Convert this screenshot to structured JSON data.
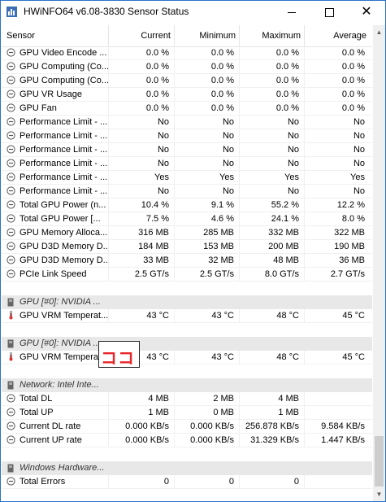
{
  "window": {
    "title": "HWiNFO64 v6.08-3830 Sensor Status"
  },
  "columns": [
    "Sensor",
    "Current",
    "Minimum",
    "Maximum",
    "Average"
  ],
  "rows": [
    {
      "kind": "sensor",
      "icon": "gauge-icon",
      "name": "GPU Video Encode ...",
      "cur": "0.0 %",
      "min": "0.0 %",
      "max": "0.0 %",
      "avg": "0.0 %"
    },
    {
      "kind": "sensor",
      "icon": "gauge-icon",
      "name": "GPU Computing (Co...",
      "cur": "0.0 %",
      "min": "0.0 %",
      "max": "0.0 %",
      "avg": "0.0 %"
    },
    {
      "kind": "sensor",
      "icon": "gauge-icon",
      "name": "GPU Computing (Co...",
      "cur": "0.0 %",
      "min": "0.0 %",
      "max": "0.0 %",
      "avg": "0.0 %"
    },
    {
      "kind": "sensor",
      "icon": "gauge-icon",
      "name": "GPU VR Usage",
      "cur": "0.0 %",
      "min": "0.0 %",
      "max": "0.0 %",
      "avg": "0.0 %"
    },
    {
      "kind": "sensor",
      "icon": "gauge-icon",
      "name": "GPU Fan",
      "cur": "0.0 %",
      "min": "0.0 %",
      "max": "0.0 %",
      "avg": "0.0 %"
    },
    {
      "kind": "sensor",
      "icon": "gauge-icon",
      "name": "Performance Limit - ...",
      "cur": "No",
      "min": "No",
      "max": "No",
      "avg": "No"
    },
    {
      "kind": "sensor",
      "icon": "gauge-icon",
      "name": "Performance Limit - ...",
      "cur": "No",
      "min": "No",
      "max": "No",
      "avg": "No"
    },
    {
      "kind": "sensor",
      "icon": "gauge-icon",
      "name": "Performance Limit - ...",
      "cur": "No",
      "min": "No",
      "max": "No",
      "avg": "No"
    },
    {
      "kind": "sensor",
      "icon": "gauge-icon",
      "name": "Performance Limit - ...",
      "cur": "No",
      "min": "No",
      "max": "No",
      "avg": "No"
    },
    {
      "kind": "sensor",
      "icon": "gauge-icon",
      "name": "Performance Limit - ...",
      "cur": "Yes",
      "min": "Yes",
      "max": "Yes",
      "avg": "Yes"
    },
    {
      "kind": "sensor",
      "icon": "gauge-icon",
      "name": "Performance Limit - ...",
      "cur": "No",
      "min": "No",
      "max": "No",
      "avg": "No"
    },
    {
      "kind": "sensor",
      "icon": "gauge-icon",
      "name": "Total GPU Power (n...",
      "cur": "10.4 %",
      "min": "9.1 %",
      "max": "55.2 %",
      "avg": "12.2 %"
    },
    {
      "kind": "sensor",
      "icon": "gauge-icon",
      "name": "Total GPU Power [...",
      "cur": "7.5 %",
      "min": "4.6 %",
      "max": "24.1 %",
      "avg": "8.0 %"
    },
    {
      "kind": "sensor",
      "icon": "gauge-icon",
      "name": "GPU Memory Alloca...",
      "cur": "316 MB",
      "min": "285 MB",
      "max": "332 MB",
      "avg": "322 MB"
    },
    {
      "kind": "sensor",
      "icon": "gauge-icon",
      "name": "GPU D3D Memory D...",
      "cur": "184 MB",
      "min": "153 MB",
      "max": "200 MB",
      "avg": "190 MB"
    },
    {
      "kind": "sensor",
      "icon": "gauge-icon",
      "name": "GPU D3D Memory D...",
      "cur": "33 MB",
      "min": "32 MB",
      "max": "48 MB",
      "avg": "36 MB"
    },
    {
      "kind": "sensor",
      "icon": "gauge-icon",
      "name": "PCIe Link Speed",
      "cur": "2.5 GT/s",
      "min": "2.5 GT/s",
      "max": "8.0 GT/s",
      "avg": "2.7 GT/s"
    },
    {
      "kind": "blank"
    },
    {
      "kind": "group",
      "icon": "sensor-chip-icon",
      "name": "GPU [#0]: NVIDIA ..."
    },
    {
      "kind": "sensor",
      "icon": "thermometer-icon",
      "name": "GPU VRM Temperat...",
      "cur": "43 °C",
      "min": "43 °C",
      "max": "48 °C",
      "avg": "45 °C"
    },
    {
      "kind": "blank"
    },
    {
      "kind": "group",
      "icon": "sensor-chip-icon",
      "name": "GPU [#0]: NVIDIA ..."
    },
    {
      "kind": "sensor",
      "icon": "thermometer-icon",
      "name": "GPU VRM Temperat...",
      "cur": "43 °C",
      "min": "43 °C",
      "max": "48 °C",
      "avg": "45 °C"
    },
    {
      "kind": "blank"
    },
    {
      "kind": "group",
      "icon": "sensor-chip-icon",
      "name": "Network: Intel Inte..."
    },
    {
      "kind": "sensor",
      "icon": "gauge-icon",
      "name": "Total DL",
      "cur": "4 MB",
      "min": "2 MB",
      "max": "4 MB",
      "avg": ""
    },
    {
      "kind": "sensor",
      "icon": "gauge-icon",
      "name": "Total UP",
      "cur": "1 MB",
      "min": "0 MB",
      "max": "1 MB",
      "avg": ""
    },
    {
      "kind": "sensor",
      "icon": "gauge-icon",
      "name": "Current DL rate",
      "cur": "0.000 KB/s",
      "min": "0.000 KB/s",
      "max": "256.878 KB/s",
      "avg": "9.584 KB/s"
    },
    {
      "kind": "sensor",
      "icon": "gauge-icon",
      "name": "Current UP rate",
      "cur": "0.000 KB/s",
      "min": "0.000 KB/s",
      "max": "31.329 KB/s",
      "avg": "1.447 KB/s"
    },
    {
      "kind": "blank"
    },
    {
      "kind": "group",
      "icon": "sensor-chip-icon",
      "name": "Windows Hardware..."
    },
    {
      "kind": "sensor",
      "icon": "gauge-icon",
      "name": "Total Errors",
      "cur": "0",
      "min": "0",
      "max": "0",
      "avg": ""
    }
  ],
  "callout": {
    "text": "ココ",
    "color": "#e8262a"
  }
}
